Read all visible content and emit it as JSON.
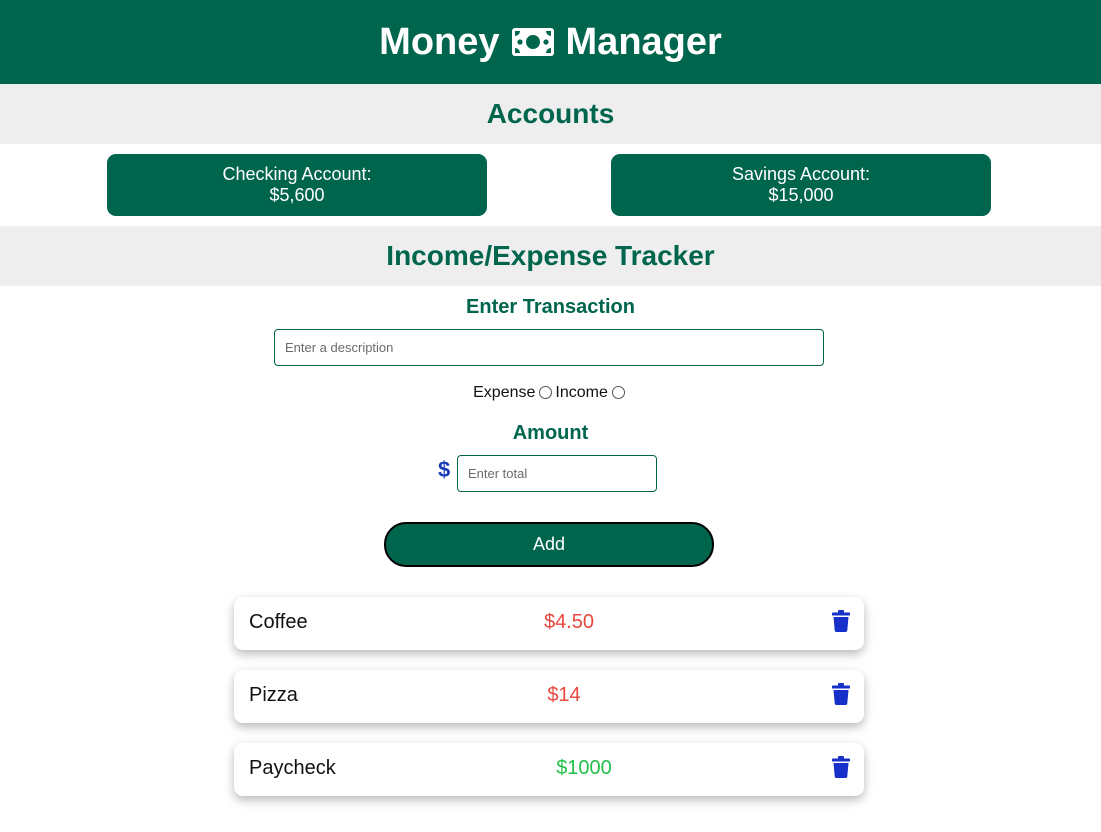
{
  "header": {
    "title_left": "Money",
    "title_right": "Manager",
    "icon": "money-bill-icon"
  },
  "accounts": {
    "title": "Accounts",
    "checking": {
      "label": "Checking Account:",
      "value": "$5,600"
    },
    "savings": {
      "label": "Savings Account:",
      "value": "$15,000"
    }
  },
  "tracker": {
    "title": "Income/Expense Tracker",
    "enter_title": "Enter Transaction",
    "description_placeholder": "Enter a description",
    "radio_expense": "Expense",
    "radio_income": "Income",
    "amount_title": "Amount",
    "currency_symbol": "$",
    "amount_placeholder": "Enter total",
    "add_label": "Add"
  },
  "transactions": [
    {
      "description": "Coffee",
      "amount": "$4.50",
      "type": "expense"
    },
    {
      "description": "Pizza",
      "amount": "$14",
      "type": "expense"
    },
    {
      "description": "Paycheck",
      "amount": "$1000",
      "type": "income"
    }
  ],
  "colors": {
    "primary": "#00654D",
    "band": "#eeeeee",
    "expense": "#e8473e",
    "income": "#21c04a",
    "accent_blue": "#1a3bb8"
  }
}
